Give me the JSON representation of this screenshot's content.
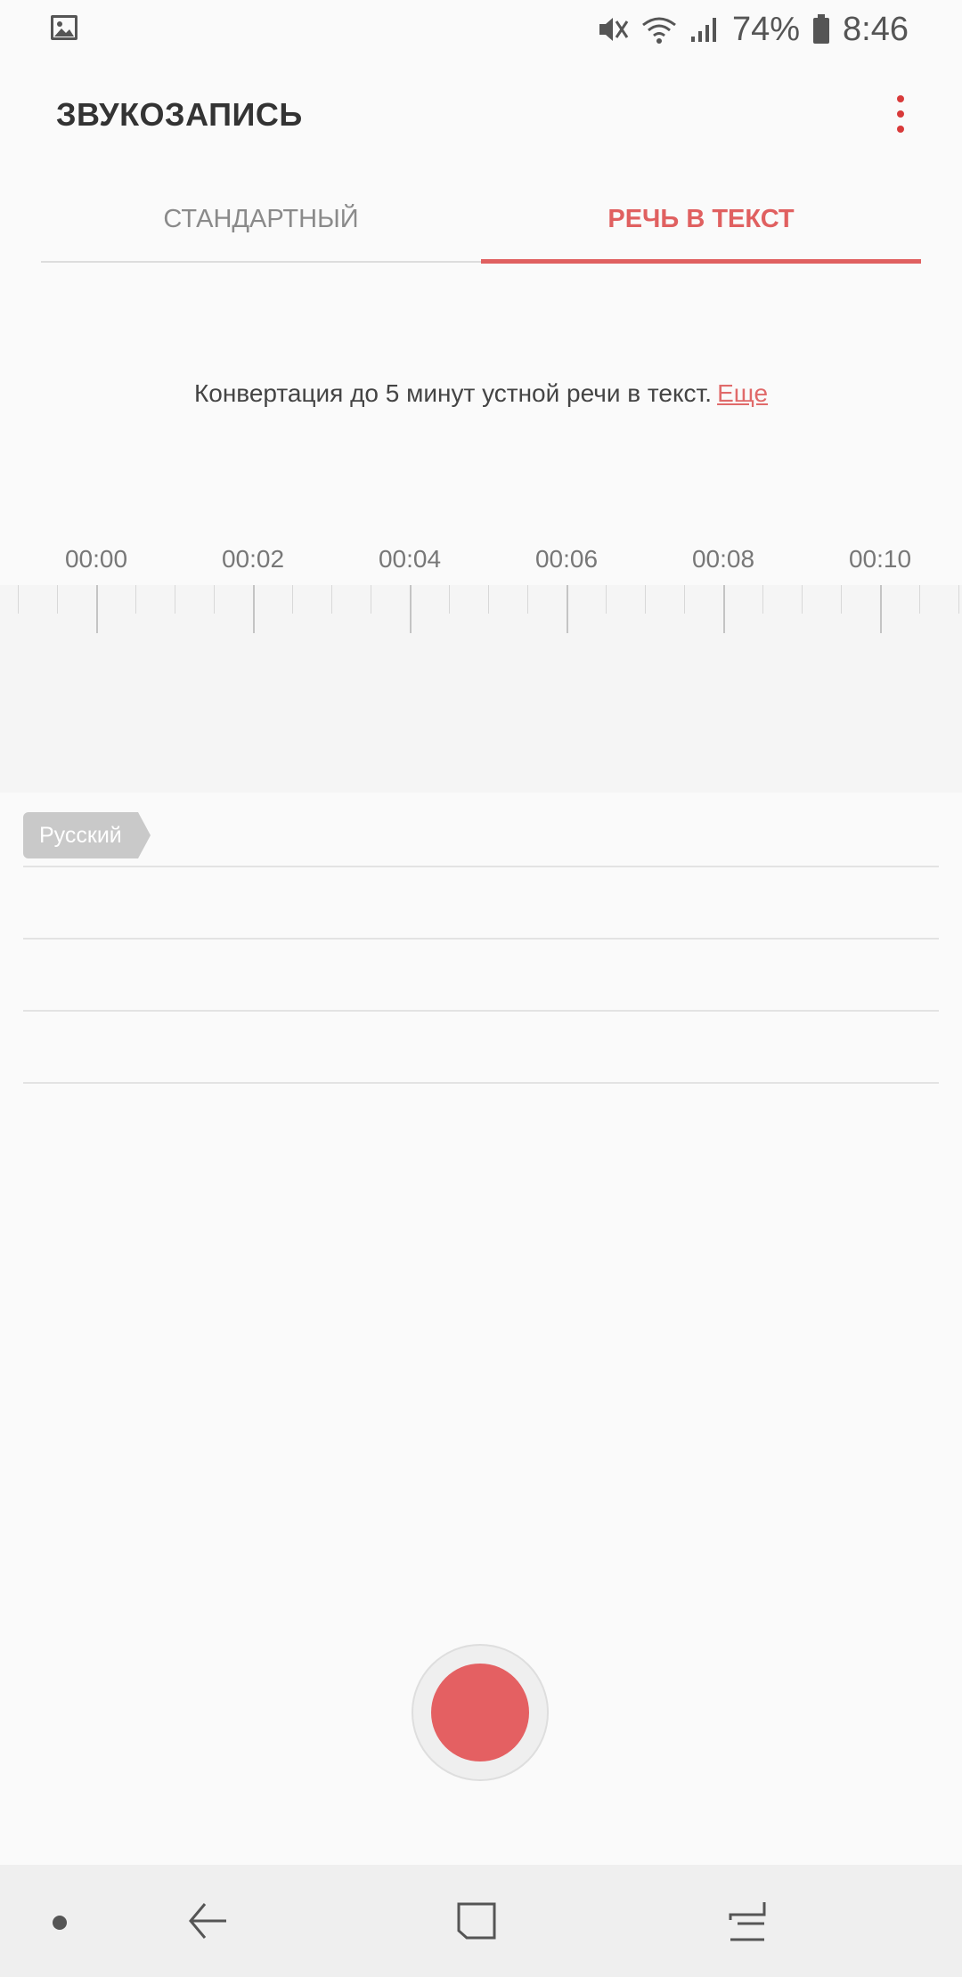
{
  "status_bar": {
    "battery_percent": "74%",
    "time": "8:46",
    "icons": [
      "gallery-icon",
      "mute-icon",
      "wifi-icon",
      "signal-icon",
      "battery-icon"
    ]
  },
  "app_bar": {
    "title": "ЗВУКОЗАПИСЬ",
    "more_icon": "more-vert-icon"
  },
  "tabs": [
    {
      "label": "СТАНДАРТНЫЙ",
      "active": false
    },
    {
      "label": "РЕЧЬ В ТЕКСТ",
      "active": true
    }
  ],
  "hint": {
    "text": "Конвертация до 5 минут устной речи в текст.",
    "link": "Еще"
  },
  "timeline": {
    "labels": [
      "00:00",
      "00:02",
      "00:04",
      "00:06",
      "00:08",
      "00:10"
    ]
  },
  "transcript": {
    "language": "Русский",
    "line_count": 4
  },
  "record_button": {
    "icon": "record-icon"
  },
  "nav_bar": {
    "icons": [
      "dot-icon",
      "back-icon",
      "home-icon",
      "recents-icon"
    ]
  },
  "colors": {
    "accent": "#e06060",
    "record": "#e46062",
    "background": "#fafafa"
  }
}
